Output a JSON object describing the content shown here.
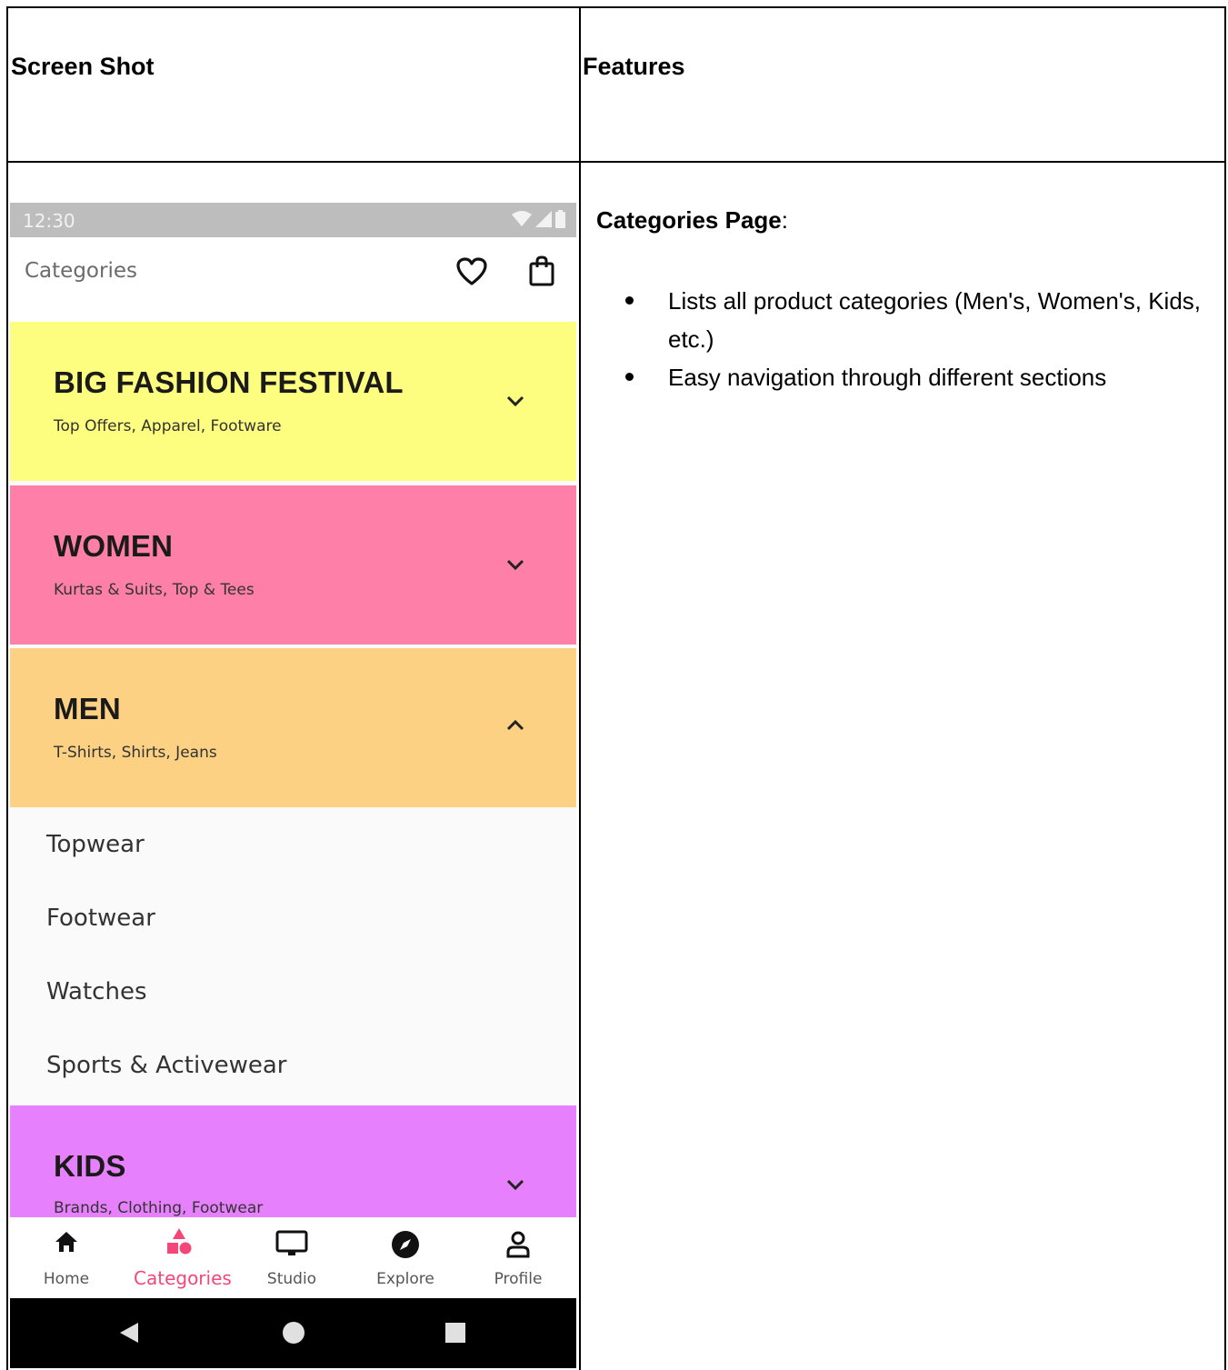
{
  "table": {
    "header_left": "Screen Shot",
    "header_right": "Features"
  },
  "phone": {
    "status_time": "12:30",
    "app_title": "Categories",
    "categories": [
      {
        "title": "BIG FASHION FESTIVAL",
        "subtitle": "Top Offers, Apparel, Footware",
        "color": "#fdfd7f",
        "expanded": false
      },
      {
        "title": "WOMEN",
        "subtitle": "Kurtas & Suits, Top & Tees",
        "color": "#fe80a8",
        "expanded": false
      },
      {
        "title": "MEN",
        "subtitle": "T-Shirts, Shirts, Jeans",
        "color": "#fdd183",
        "expanded": true
      },
      {
        "title": "KIDS",
        "subtitle": "Brands, Clothing, Footwear",
        "color": "#e780fd",
        "expanded": false
      }
    ],
    "men_subcategories": [
      "Topwear",
      "Footwear",
      "Watches",
      "Sports & Activewear"
    ],
    "bottom_nav": [
      {
        "label": "Home",
        "icon": "home-icon",
        "active": false
      },
      {
        "label": "Categories",
        "icon": "categories-icon",
        "active": true
      },
      {
        "label": "Studio",
        "icon": "studio-icon",
        "active": false
      },
      {
        "label": "Explore",
        "icon": "explore-icon",
        "active": false
      },
      {
        "label": "Profile",
        "icon": "profile-icon",
        "active": false
      }
    ],
    "accent_color": "#f5467a"
  },
  "features": {
    "heading": "Categories Page",
    "heading_suffix": ":",
    "items": [
      "Lists all product categories (Men's, Women's, Kids, etc.)",
      "Easy navigation through different sections"
    ]
  }
}
